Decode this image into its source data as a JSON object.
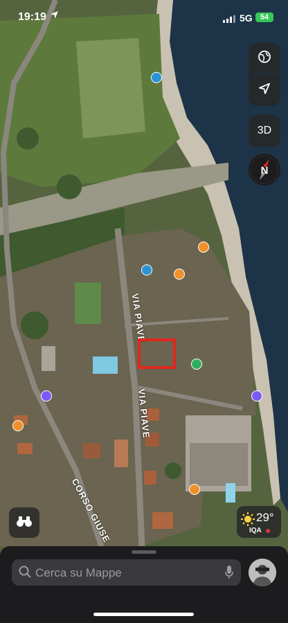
{
  "status_bar": {
    "time": "19:19",
    "network": "5G",
    "battery": "54"
  },
  "map_controls": {
    "mode_3d_label": "3D",
    "compass_label": "N"
  },
  "map_labels": {
    "via_piave_north": "VIA PIAVE",
    "via_piave_south": "VIA PIAVE",
    "corso": "CORSO GIUSE"
  },
  "weather": {
    "temperature": "29°",
    "aqi_label": "IQA"
  },
  "search": {
    "placeholder": "Cerca su Mappe"
  },
  "colors": {
    "highlight": "#e3261d",
    "battery": "#34c759",
    "lake": "#1d3347",
    "poi_beach": "#2a93d5",
    "poi_food": "#f0902b",
    "poi_hotel": "#7a5af5",
    "poi_camping": "#2fae5e"
  }
}
